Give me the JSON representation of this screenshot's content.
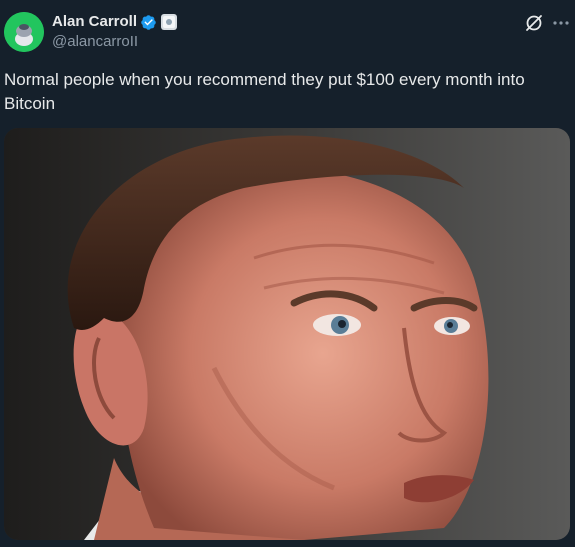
{
  "tweet": {
    "author": {
      "display_name": "Alan Carroll",
      "handle": "@alancarroII",
      "verified": true,
      "avatar_color": "#22c55e"
    },
    "text": "Normal people when you recommend they put $100 every month into Bitcoin",
    "media": {
      "type": "image",
      "subject": "man-looking-sideways"
    }
  },
  "icons": {
    "verified": "verified-badge-icon",
    "affiliate": "affiliate-badge-icon",
    "grok": "grok-icon",
    "more": "more-options-icon"
  },
  "colors": {
    "background": "#15202b",
    "text_primary": "#e7e9ea",
    "text_secondary": "#8b98a5",
    "verified_blue": "#1d9bf0"
  }
}
